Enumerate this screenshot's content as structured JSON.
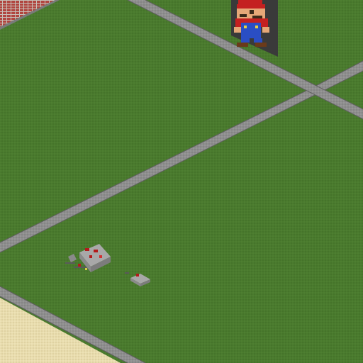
{
  "scene": {
    "view": "isometric",
    "colors": {
      "grass": "#4a7a2e",
      "grass_dark": "#42702a",
      "road": "#8e8e8e",
      "road_edge": "#5f5f5f",
      "sand": "#e8dcae",
      "redstone": "#b31b1b",
      "stone": "#a8a8a8",
      "pixel_art_frame": "#3a3a3a"
    },
    "objects": [
      {
        "name": "grass-field",
        "kind": "terrain"
      },
      {
        "name": "road-lower-diagonal",
        "kind": "road"
      },
      {
        "name": "road-upper-diagonal",
        "kind": "road"
      },
      {
        "name": "road-top-left",
        "kind": "road"
      },
      {
        "name": "road-bottom-left",
        "kind": "road"
      },
      {
        "name": "sand-patch",
        "kind": "terrain"
      },
      {
        "name": "brick-structure",
        "kind": "building"
      },
      {
        "name": "mario-pixel-art",
        "kind": "pixel-art",
        "depicts": "Mario"
      },
      {
        "name": "redstone-contraption-large",
        "kind": "machine"
      },
      {
        "name": "redstone-contraption-small",
        "kind": "machine"
      }
    ]
  }
}
